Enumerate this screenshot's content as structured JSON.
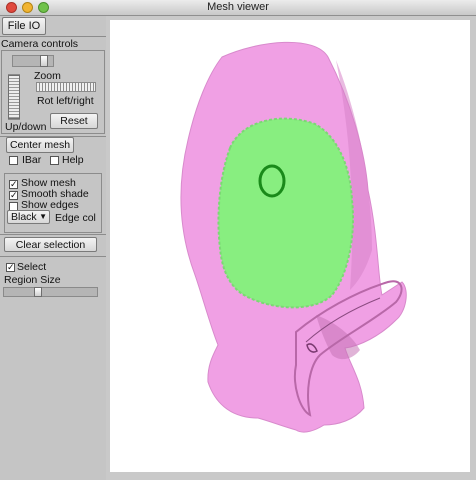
{
  "window": {
    "title": "Mesh viewer"
  },
  "panel": {
    "file_io_tab": "File IO",
    "camera_controls_label": "Camera controls",
    "zoom_label": "Zoom",
    "rot_label": "Rot left/right",
    "updown_label": "Up/down",
    "reset_button": "Reset",
    "center_mesh_button": "Center mesh",
    "ibar_label": "IBar",
    "ibar_checked": false,
    "help_label": "Help",
    "help_checked": false,
    "show_mesh_label": "Show mesh",
    "show_mesh_checked": true,
    "smooth_shade_label": "Smooth shade",
    "smooth_shade_checked": true,
    "show_edges_label": "Show edges",
    "show_edges_checked": false,
    "edge_color_value": "Black",
    "edge_col_label": "Edge col",
    "clear_selection_button": "Clear selection",
    "select_label": "Select",
    "select_checked": true,
    "region_size_label": "Region Size"
  },
  "colors": {
    "mesh": "#f0a0e4",
    "selected_region": "#88ee80",
    "marker": "#1a8a1a"
  }
}
